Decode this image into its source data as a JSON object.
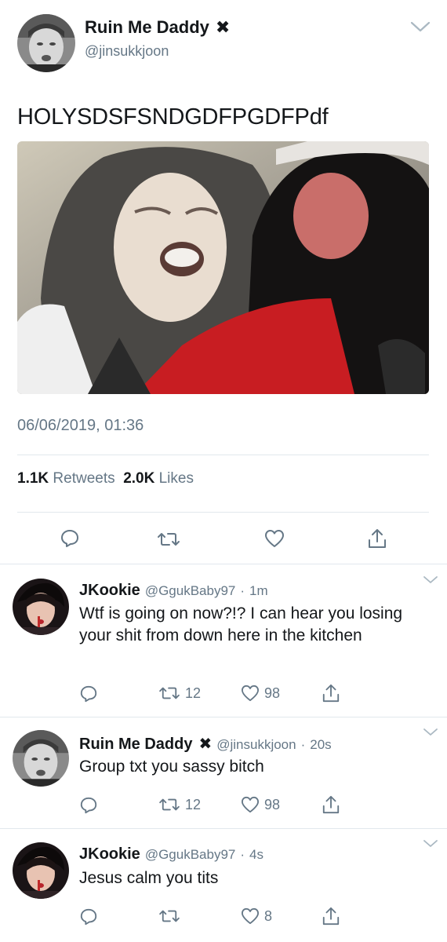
{
  "main_tweet": {
    "display_name": "Ruin Me Daddy",
    "name_mark": "✖",
    "handle": "@jinsukkjoon",
    "text": "HOLYSDSFSNDGDFPGDFPdf",
    "timestamp": "06/06/2019, 01:36",
    "retweets_count": "1.1K",
    "retweets_label": "Retweets",
    "likes_count": "2.0K",
    "likes_label": "Likes"
  },
  "replies": [
    {
      "display_name": "JKookie",
      "handle": "@GgukBaby97",
      "separator": "·",
      "time": "1m",
      "text": "Wtf is going on now?!? I can hear you losing your shit from down here in the kitchen",
      "retweets": "12",
      "likes": "98"
    },
    {
      "display_name": "Ruin Me Daddy",
      "name_mark": "✖",
      "handle": "@jinsukkjoon",
      "separator": "·",
      "time": "20s",
      "text": "Group txt you sassy bitch",
      "retweets": "12",
      "likes": "98"
    },
    {
      "display_name": "JKookie",
      "handle": "@GgukBaby97",
      "separator": "·",
      "time": "4s",
      "text": "Jesus calm you tits",
      "retweets": "",
      "likes": "8"
    }
  ],
  "icons": {
    "reply": "reply-icon",
    "retweet": "retweet-icon",
    "like": "heart-icon",
    "share": "share-icon",
    "more": "chevron-down-icon"
  },
  "colors": {
    "text_primary": "#14171a",
    "text_secondary": "#657786",
    "divider": "#e1e8ed"
  }
}
